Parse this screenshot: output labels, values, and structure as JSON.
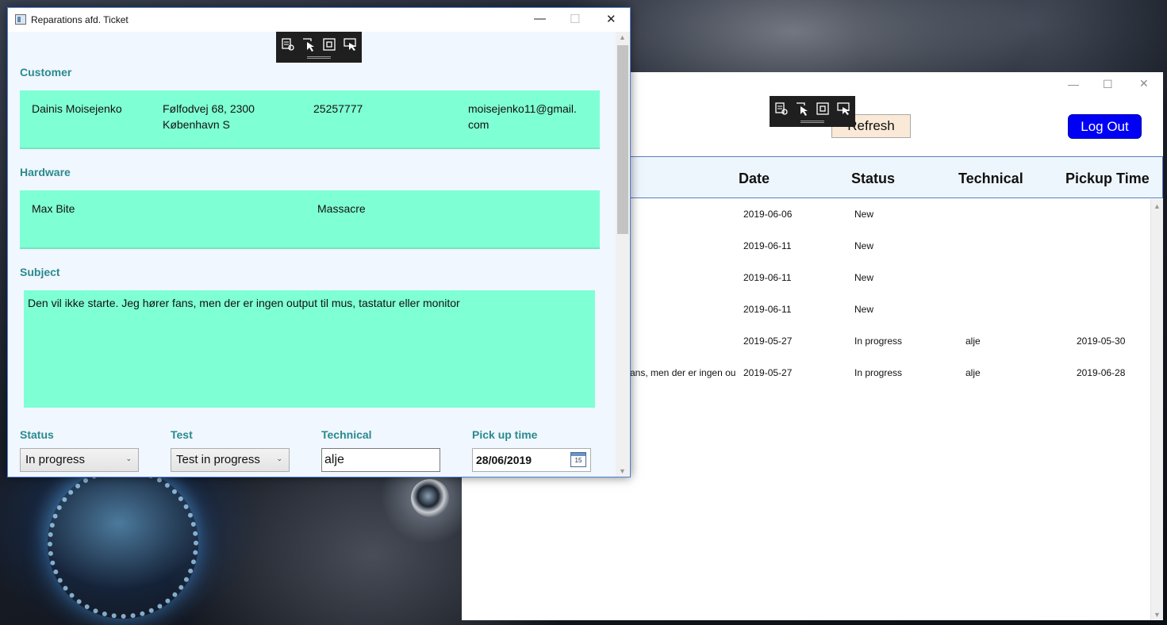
{
  "ticket_window": {
    "title": "Reparations afd. Ticket",
    "customer": {
      "label": "Customer",
      "name": "Dainis Moisejenko",
      "address_line1": "Følfodvej 68, 2300",
      "address_line2": "København S",
      "phone": "25257777",
      "email_line1": "moisejenko11@gmail.",
      "email_line2": "com"
    },
    "hardware": {
      "label": "Hardware",
      "brand": "Max Bite",
      "model": "Massacre"
    },
    "subject": {
      "label": "Subject",
      "text": "Den vil ikke starte. Jeg hører fans, men der er ingen output til mus, tastatur eller monitor"
    },
    "fields": {
      "status_label": "Status",
      "status_value": "In progress",
      "test_label": "Test",
      "test_value": "Test in progress",
      "technical_label": "Technical",
      "technical_value": "alje",
      "pickup_label": "Pick up time",
      "pickup_value": "28/06/2019",
      "calendar_day": "15"
    }
  },
  "main_window": {
    "refresh_label": "Refresh",
    "logout_label": "Log Out",
    "columns": [
      "Date",
      "Status",
      "Technical",
      "Pickup Time"
    ],
    "rows": [
      {
        "subject": "",
        "date": "2019-06-06",
        "status": "New",
        "technical": "",
        "pickup": ""
      },
      {
        "subject": "",
        "date": "2019-06-11",
        "status": "New",
        "technical": "",
        "pickup": ""
      },
      {
        "subject": "",
        "date": "2019-06-11",
        "status": "New",
        "technical": "",
        "pickup": ""
      },
      {
        "subject": "",
        "date": "2019-06-11",
        "status": "New",
        "technical": "",
        "pickup": ""
      },
      {
        "subject": "",
        "date": "2019-05-27",
        "status": "In progress",
        "technical": "alje",
        "pickup": "2019-05-30"
      },
      {
        "subject": "ans, men der er ingen out",
        "date": "2019-05-27",
        "status": "In progress",
        "technical": "alje",
        "pickup": "2019-06-28"
      }
    ]
  },
  "icons": {
    "window_minimize": "—",
    "window_maximize": "☐",
    "window_close": "✕",
    "dropdown": "⌄",
    "scroll_up": "▲",
    "scroll_down": "▼"
  }
}
